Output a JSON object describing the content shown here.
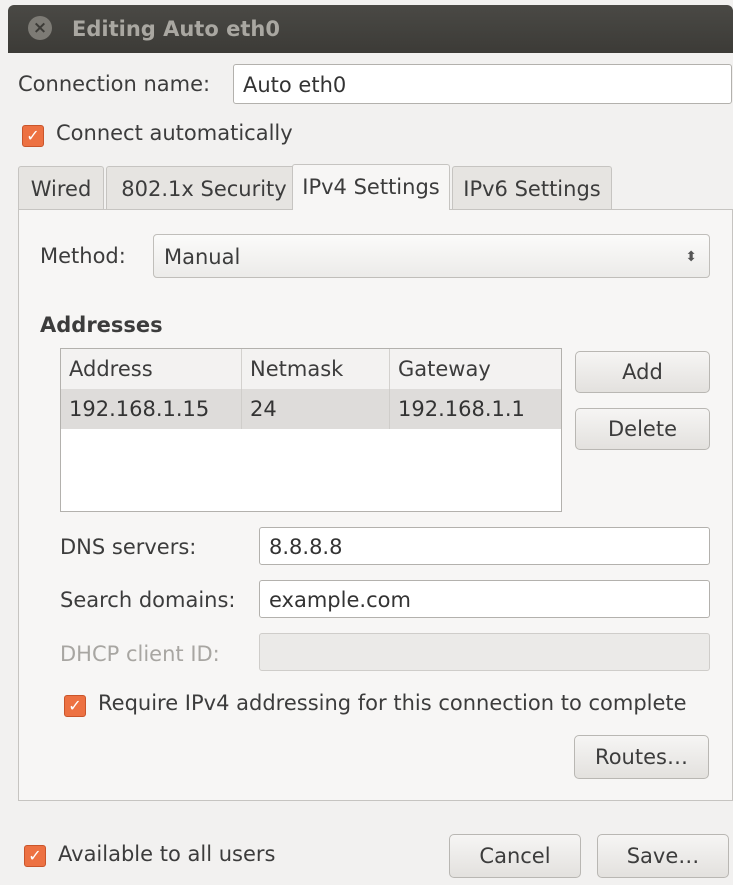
{
  "window": {
    "title": "Editing Auto eth0",
    "close_glyph": "×"
  },
  "connection": {
    "name_label": "Connection name:",
    "name_value": "Auto eth0",
    "connect_auto_label": "Connect automatically",
    "connect_auto_checked": true
  },
  "tabs": [
    {
      "label": "Wired",
      "active": false
    },
    {
      "label": "802.1x Security",
      "active": false
    },
    {
      "label": "IPv4 Settings",
      "active": true
    },
    {
      "label": "IPv6 Settings",
      "active": false
    }
  ],
  "ipv4": {
    "method_label": "Method:",
    "method_value": "Manual",
    "addresses_heading": "Addresses",
    "columns": [
      "Address",
      "Netmask",
      "Gateway"
    ],
    "rows": [
      [
        "192.168.1.15",
        "24",
        "192.168.1.1"
      ]
    ],
    "add_label": "Add",
    "delete_label": "Delete",
    "dns_label": "DNS servers:",
    "dns_value": "8.8.8.8",
    "search_label": "Search domains:",
    "search_value": "example.com",
    "dhcp_label": "DHCP client ID:",
    "dhcp_value": "",
    "require_label": "Require IPv4 addressing for this connection to complete",
    "require_checked": true,
    "routes_label": "Routes…"
  },
  "footer": {
    "all_users_label": "Available to all users",
    "all_users_checked": true,
    "cancel_label": "Cancel",
    "save_label": "Save…"
  },
  "colors": {
    "accent": "#ed7142",
    "titlebar": "#3c3b37",
    "title_text": "#a9a7a1"
  }
}
